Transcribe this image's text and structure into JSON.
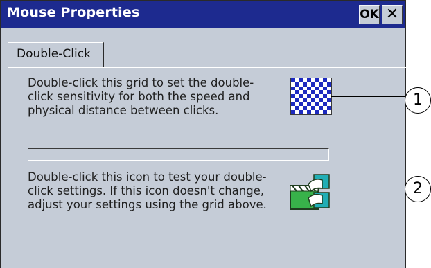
{
  "window": {
    "title": "Mouse Properties",
    "ok_label": "OK",
    "close_label": "✕"
  },
  "tab": {
    "label": "Double-Click"
  },
  "grid_section": {
    "text": "Double-click this grid to set the double-click sensitivity for both the speed and physical distance between clicks.",
    "icon": "checkerboard-grid-icon"
  },
  "test_section": {
    "text": "Double-click this icon to test your double-click settings. If this icon doesn't change, adjust your settings using the grid above.",
    "icon": "clapperboard-test-icon"
  },
  "callouts": [
    {
      "label": "1"
    },
    {
      "label": "2"
    }
  ],
  "colors": {
    "title_bar": "#1d2a8f",
    "window_bg": "#c5ccd7",
    "grid_dark": "#1d2abf",
    "grid_light": "#ffffff",
    "icon_green": "#38b24a",
    "icon_teal": "#20aeb5"
  }
}
